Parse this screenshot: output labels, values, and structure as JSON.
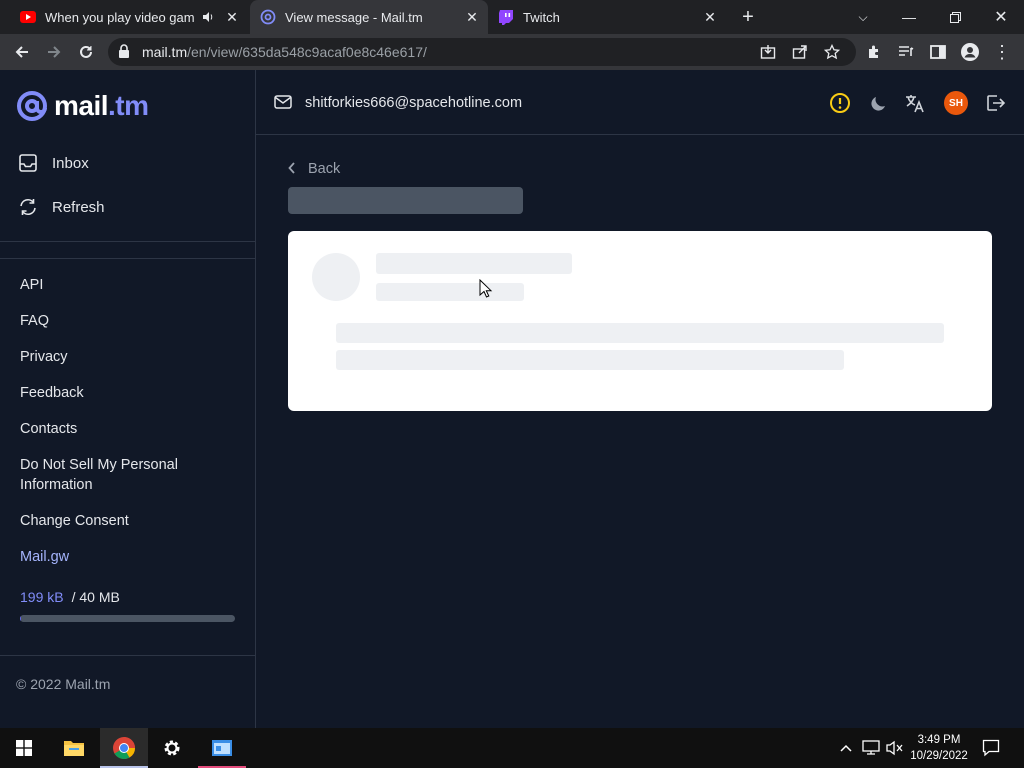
{
  "browser": {
    "tabs": [
      {
        "title": "When you play video games",
        "icon": "youtube-icon"
      },
      {
        "title": "View message - Mail.tm",
        "icon": "mailtm-icon"
      },
      {
        "title": "Twitch",
        "icon": "twitch-icon"
      }
    ],
    "url": {
      "host": "mail.tm",
      "path": "/en/view/635da548c9acaf0e8c46e617/"
    }
  },
  "sidebar": {
    "logo": {
      "name": "mail",
      "tld": ".tm"
    },
    "nav": [
      {
        "label": "Inbox",
        "icon": "inbox-icon"
      },
      {
        "label": "Refresh",
        "icon": "refresh-icon"
      }
    ],
    "links": [
      "API",
      "FAQ",
      "Privacy",
      "Feedback",
      "Contacts",
      "Do Not Sell My Personal Information",
      "Change Consent",
      "Mail.gw"
    ],
    "quota": {
      "used": "199 kB",
      "total": "/ 40 MB",
      "fraction": 0.005
    },
    "copyright": "© 2022 Mail.tm"
  },
  "header": {
    "address": "shitforkies666@spacehotline.com",
    "avatar_initials": "SH",
    "icons": [
      "alert-icon",
      "moon-icon",
      "translate-icon",
      "logout-icon"
    ]
  },
  "message": {
    "back_label": "Back"
  },
  "taskbar": {
    "time": "3:49 PM",
    "date": "10/29/2022"
  },
  "colors": {
    "background": "#111827",
    "accent": "#818cf8",
    "alert": "#facc15",
    "avatar": "#ea580c"
  }
}
